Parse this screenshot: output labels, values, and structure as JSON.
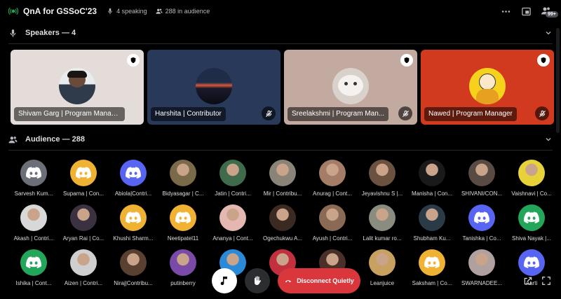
{
  "header": {
    "title": "QnA for GSSoC'23",
    "speaking": "4 speaking",
    "audience_count": "288 in audience",
    "badge": "99+"
  },
  "speakers": {
    "header": "Speakers — 4",
    "tiles": [
      {
        "name": "Shivam Garg | Program Manager",
        "bg": "#e4dcd8",
        "moderator": true,
        "muted": false,
        "active": true
      },
      {
        "name": "Harshita | Contributor",
        "bg": "#28395a",
        "moderator": false,
        "muted": true,
        "active": false
      },
      {
        "name": "Sreelakshmi | Program Man...",
        "bg": "#c3aaa0",
        "moderator": true,
        "muted": true,
        "active": false
      },
      {
        "name": "Nawed | Program Manager",
        "bg": "#d23a1f",
        "moderator": true,
        "muted": true,
        "active": false
      }
    ]
  },
  "audience": {
    "header": "Audience — 288",
    "members": [
      {
        "name": "Sarvesh Kum...",
        "kind": "discord",
        "color": "#6d6f78"
      },
      {
        "name": "Suparna | Con...",
        "kind": "discord",
        "color": "#f0b232"
      },
      {
        "name": "Abiola|Contri...",
        "kind": "discord",
        "color": "#5865f2"
      },
      {
        "name": "Bidyasagar | C...",
        "kind": "photo",
        "color": "#7b6a4a"
      },
      {
        "name": "Jatin | Contri...",
        "kind": "photo",
        "color": "#3f6b4a"
      },
      {
        "name": "Mir | Contribu...",
        "kind": "photo",
        "color": "#8a8478"
      },
      {
        "name": "Anurag | Cont...",
        "kind": "photo",
        "color": "#a57c68"
      },
      {
        "name": "Jeyavishnu S |...",
        "kind": "photo",
        "color": "#6b5240"
      },
      {
        "name": "Manisha | Con...",
        "kind": "photo",
        "color": "#1a1a1a"
      },
      {
        "name": "SHIVANI/CON...",
        "kind": "photo",
        "color": "#5a4a44"
      },
      {
        "name": "Vaishnavi | Co...",
        "kind": "photo",
        "color": "#e8d23a"
      },
      {
        "name": "Akash | Contri...",
        "kind": "photo",
        "color": "#d8d8d8"
      },
      {
        "name": "Aryan Rai | Co...",
        "kind": "photo",
        "color": "#3a3240"
      },
      {
        "name": "Khushi Sharm...",
        "kind": "discord",
        "color": "#f0b232"
      },
      {
        "name": "Neetipatel11",
        "kind": "discord",
        "color": "#f0b232"
      },
      {
        "name": "Ananya | Cont...",
        "kind": "photo",
        "color": "#e4b8b0"
      },
      {
        "name": "Ogechukwu A...",
        "kind": "photo",
        "color": "#3a2a22"
      },
      {
        "name": "Ayush | Contri...",
        "kind": "photo",
        "color": "#8a6a54"
      },
      {
        "name": "Lalit kumar ro...",
        "kind": "photo",
        "color": "#8a8c80"
      },
      {
        "name": "Shubham Ku...",
        "kind": "photo",
        "color": "#2a3a46"
      },
      {
        "name": "Tanishka | Co...",
        "kind": "discord",
        "color": "#5865f2"
      },
      {
        "name": "Shiva Nayak |...",
        "kind": "discord",
        "color": "#23a55a"
      },
      {
        "name": "Ishika | Cont...",
        "kind": "discord",
        "color": "#23a55a"
      },
      {
        "name": "Aizen | Contri...",
        "kind": "photo",
        "color": "#cfcfcf"
      },
      {
        "name": "Niraj|Contribu...",
        "kind": "photo",
        "color": "#5a4030"
      },
      {
        "name": "putinberry",
        "kind": "photo",
        "color": "#7a4aa8"
      },
      {
        "name": "",
        "kind": "photo",
        "color": "#2a8ad8"
      },
      {
        "name": "",
        "kind": "photo",
        "color": "#c23040"
      },
      {
        "name": "",
        "kind": "photo",
        "color": "#4a3028"
      },
      {
        "name": "Leanjuice",
        "kind": "photo",
        "color": "#c8a060"
      },
      {
        "name": "Saksham | Co...",
        "kind": "discord",
        "color": "#f0b232"
      },
      {
        "name": "SWARNADEE...",
        "kind": "photo",
        "color": "#b0a0a0"
      },
      {
        "name": "Aarti",
        "kind": "discord",
        "color": "#5865f2"
      }
    ]
  },
  "controls": {
    "disconnect_label": "Disconnect Quietly",
    "music_icon": "music-note-icon",
    "hand_icon": "raise-hand-icon"
  }
}
